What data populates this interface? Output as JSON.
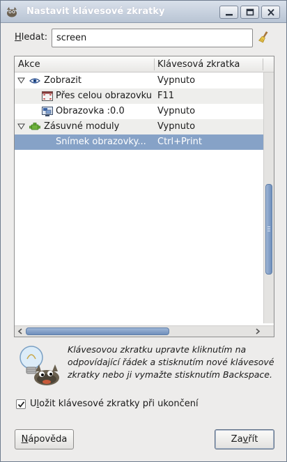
{
  "window": {
    "title": "Nastavit klávesové zkratky"
  },
  "search": {
    "label_prefix": "H",
    "label_rest": "ledat:",
    "value": "screen"
  },
  "table": {
    "columns": [
      "Akce",
      "Klávesová zkratka"
    ],
    "rows": [
      {
        "indent": 0,
        "expanded": true,
        "icon": "eye-icon",
        "action": "Zobrazit",
        "shortcut": "Vypnuto"
      },
      {
        "indent": 1,
        "icon": "fullscreen-icon",
        "action": "Přes celou obrazovku",
        "shortcut": "F11"
      },
      {
        "indent": 1,
        "icon": "screen-icon",
        "action": "Obrazovka :0.0",
        "shortcut": "Vypnuto"
      },
      {
        "indent": 0,
        "expanded": true,
        "icon": "plugin-icon",
        "action": "Zásuvné moduly",
        "shortcut": "Vypnuto"
      },
      {
        "indent": 1,
        "icon": "",
        "action": "Snímek obrazovky...",
        "shortcut": "Ctrl+Print",
        "selected": true
      }
    ]
  },
  "hint": {
    "text": "Klávesovou zkratku upravte kliknutím na odpovídající řádek a stisknutím nové klávesové zkratky nebo ji vymažte stisknutím Backspace."
  },
  "save_checkbox": {
    "checked": true,
    "label_pre": "U",
    "label_ul": "l",
    "label_post": "ožit klávesové zkratky při ukončení"
  },
  "buttons": {
    "help_ul": "N",
    "help_rest": "ápověda",
    "close_pre": "Za",
    "close_ul": "v",
    "close_post": "řít"
  },
  "colors": {
    "selection": "#86a2c7",
    "titlebar": "#b8c4d4"
  }
}
